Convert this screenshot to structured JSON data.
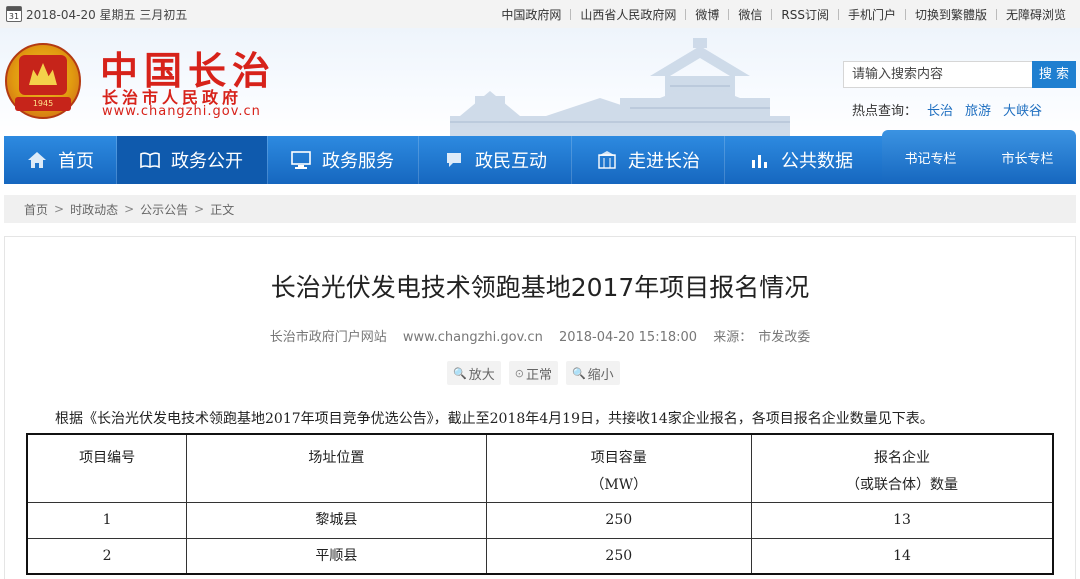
{
  "topbar": {
    "date_icon_num": "31",
    "date_text": "2018-04-20 星期五 三月初五",
    "links": [
      "中国政府网",
      "山西省人民政府网",
      "微博",
      "微信",
      "RSS订阅",
      "手机门户",
      "切换到繁體版",
      "无障碍浏览"
    ]
  },
  "header": {
    "emblem_caption": "中国长治",
    "emblem_year": "1945",
    "brand_main": "中国长治",
    "brand_sub": "长治市人民政府",
    "brand_url": "www.changzhi.gov.cn",
    "search": {
      "placeholder": "请输入搜索内容",
      "button": "搜 索"
    },
    "hot": {
      "label": "热点查询：",
      "items": [
        "长治",
        "旅游",
        "大峡谷"
      ]
    }
  },
  "nav": {
    "items": [
      {
        "label": "首页",
        "icon": "home-icon"
      },
      {
        "label": "政务公开",
        "icon": "book-icon"
      },
      {
        "label": "政务服务",
        "icon": "monitor-icon"
      },
      {
        "label": "政民互动",
        "icon": "chat-icon"
      },
      {
        "label": "走进长治",
        "icon": "building-icon"
      },
      {
        "label": "公共数据",
        "icon": "bar-chart-icon"
      }
    ],
    "right": [
      "书记专栏",
      "市长专栏"
    ]
  },
  "breadcrumb": [
    "首页",
    "时政动态",
    "公示公告",
    "正文"
  ],
  "article": {
    "title": "长治光伏发电技术领跑基地2017年项目报名情况",
    "meta": {
      "source_site": "长治市政府门户网站",
      "url": "www.changzhi.gov.cn",
      "datetime": "2018-04-20 15:18:00",
      "source_label": "来源：",
      "source": "市发改委"
    },
    "zoom": [
      "放大",
      "正常",
      "缩小"
    ],
    "intro": "根据《长治光伏发电技术领跑基地2017年项目竞争优选公告》，截止至2018年4月19日，共接收14家企业报名，各项目报名企业数量见下表。",
    "table": {
      "headers": [
        {
          "line1": "项目编号",
          "line2": ""
        },
        {
          "line1": "场址位置",
          "line2": ""
        },
        {
          "line1": "项目容量",
          "line2": "（MW）"
        },
        {
          "line1": "报名企业",
          "line2": "（或联合体）数量"
        }
      ],
      "rows": [
        [
          "1",
          "黎城县",
          "250",
          "13"
        ],
        [
          "2",
          "平顺县",
          "250",
          "14"
        ]
      ]
    }
  }
}
